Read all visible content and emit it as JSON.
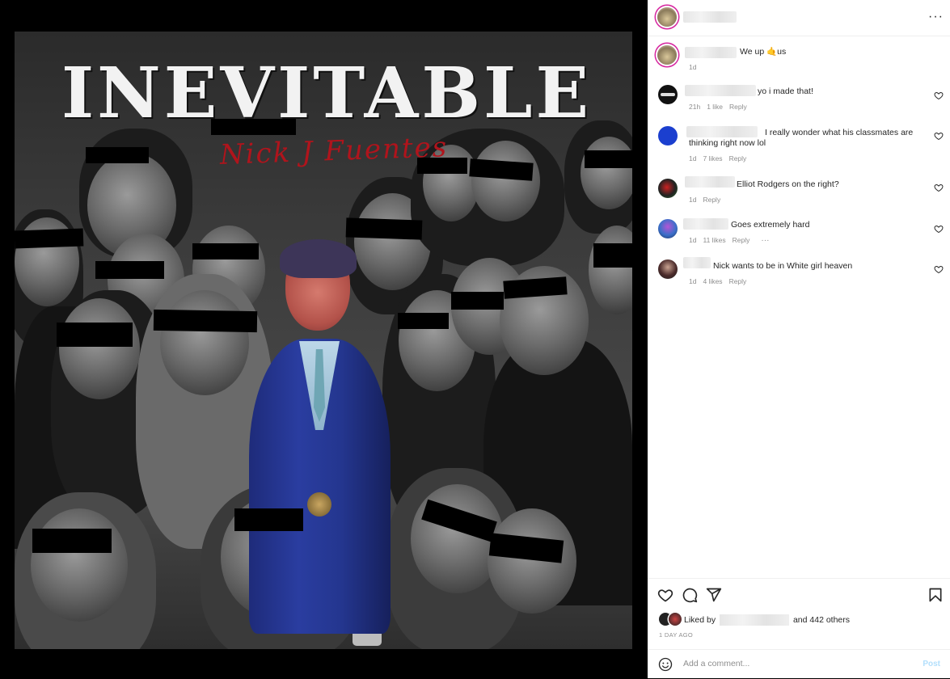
{
  "post": {
    "image": {
      "title": "INEVITABLE",
      "artist": "Nick J Fuentes"
    }
  },
  "header": {
    "more_label": "···"
  },
  "caption": {
    "text": "We up 🤙us",
    "time": "1d"
  },
  "comments": [
    {
      "text": "yo i made that!",
      "time": "21h",
      "likes": "1 like",
      "reply": "Reply"
    },
    {
      "text": "I really wonder what his classmates are thinking right now lol",
      "time": "1d",
      "likes": "7 likes",
      "reply": "Reply"
    },
    {
      "text": "Elliot Rodgers on the right?",
      "time": "1d",
      "likes": "",
      "reply": "Reply"
    },
    {
      "text": "Goes extremely hard",
      "time": "1d",
      "likes": "11 likes",
      "reply": "Reply",
      "more": "···"
    },
    {
      "text": "Nick wants to be in White girl heaven",
      "time": "1d",
      "likes": "4 likes",
      "reply": "Reply"
    }
  ],
  "actions": {
    "liked_by_prefix": "Liked by",
    "liked_by_suffix": "and 442 others",
    "date": "1 DAY AGO"
  },
  "comment_box": {
    "placeholder": "Add a comment...",
    "post_label": "Post"
  },
  "colors": {
    "accent": "#0095f6",
    "post_disabled": "#b2dffc",
    "muted": "#8e8e8e",
    "title_red": "#b0141c"
  }
}
